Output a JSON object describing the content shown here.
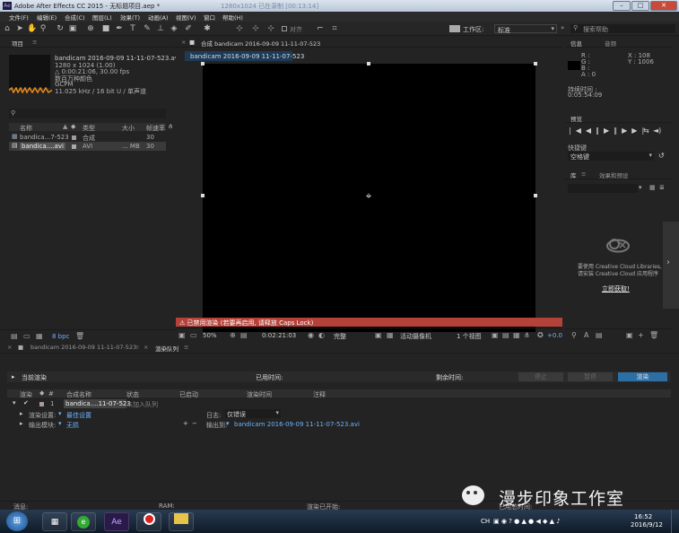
{
  "app": {
    "title": "Adobe After Effects CC 2015 - 无标题项目.aep *",
    "ghost_title": "1280x1024   已在录制 [00:13:14]"
  },
  "menu": [
    "文件(F)",
    "编辑(E)",
    "合成(C)",
    "图层(L)",
    "效果(T)",
    "动画(A)",
    "视图(V)",
    "窗口",
    "帮助(H)"
  ],
  "toolbar": {
    "snap": "对齐",
    "workspace_label": "工作区:",
    "workspace_value": "标准",
    "search_placeholder": "搜索帮助"
  },
  "project": {
    "title": "项目",
    "file": "bandicam 2016-09-09 11-11-07-523.avi ▾ , 使用了 1 次",
    "info": [
      "1280 x 1024 (1.00)",
      "△ 0:00:21:06, 30.00 fps",
      "数百万种颜色",
      "GCPM",
      "11.025 kHz / 16 bit U / 单声道"
    ],
    "columns": [
      "名称",
      "类型",
      "大小",
      "帧速率"
    ],
    "rows": [
      {
        "name": "bandica...7-523",
        "type": "合成",
        "size": "",
        "fps": "30"
      },
      {
        "name": "bandica....avi",
        "type": "AVI",
        "size": "... MB",
        "fps": "30"
      }
    ],
    "bpc": "8 bpc"
  },
  "comp": {
    "tab": "合成 bandicam 2016-09-09 11-11-07-523",
    "subtab": "bandicam 2016-09-09 11-11-07-523",
    "warning": "⚠ 已禁用渲染 (若要再启用, 请释放 Caps Lock)",
    "zoom": "50%",
    "timecode": "0:02:21:03",
    "quality": "完整",
    "camera": "活动摄像机",
    "views": "1 个视图",
    "exposure": "+0.0"
  },
  "info_panel": {
    "tab1": "信息",
    "tab2": "音频",
    "rgba": [
      "R :",
      "G :",
      "B :",
      "A : 0"
    ],
    "xy": [
      "X : 108",
      "Y : 1006"
    ],
    "render_label": "持续时间 :",
    "render_time": "0:05:54:09"
  },
  "preview": {
    "title": "预览",
    "shortcut_label": "快捷键",
    "shortcut_value": "空格键"
  },
  "library": {
    "tab1": "库",
    "tab2": "效果和预设",
    "msg1": "要使用 Creative Cloud Libraries,",
    "msg2": "请安装 Creative Cloud 应用程序",
    "link": "立即获取!"
  },
  "timeline": {
    "tab1": "bandicam 2016-09-09 11-11-07-523",
    "tab2": "渲染队列"
  },
  "render_queue": {
    "current": "当前渲染",
    "elapsed": "已用时间:",
    "remaining": "剩余时间:",
    "stop": "停止",
    "pause": "暂停",
    "render": "渲染",
    "cols": [
      "渲染",
      "#",
      "合成名称",
      "状态",
      "已启动",
      "渲染时间",
      "注释"
    ],
    "row_name": "bandica....11-07-523",
    "row_status": "未加入队列",
    "settings_label": "渲染设置:",
    "settings_value": "最佳设置",
    "module_label": "输出模块:",
    "module_value": "无损",
    "log_label": "日志:",
    "log_value": "仅错误",
    "output_label": "输出到:",
    "output_value": "bandicam 2016-09-09 11-11-07-523.avi",
    "messages": "消息:",
    "ram": "RAM:",
    "render_start": "渲染已开始:",
    "total_time": "已用总时间:"
  },
  "watermark": "漫步印象工作室",
  "taskbar": {
    "time": "16:52",
    "date": "2016/9/12",
    "lang": "CH"
  }
}
